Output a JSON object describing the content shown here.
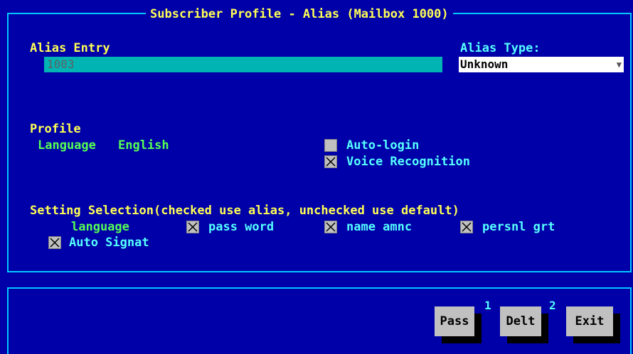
{
  "window": {
    "title": "Subscriber Profile - Alias (Mailbox 1000)"
  },
  "alias": {
    "entry_label": "Alias Entry",
    "entry_value": "1003",
    "type_label": "Alias Type:",
    "type_value": "Unknown"
  },
  "profile": {
    "heading": "Profile",
    "language_label": "Language",
    "language_value": "English",
    "auto_login_label": "Auto-login",
    "auto_login_checked": false,
    "voice_recognition_label": "Voice Recognition",
    "voice_recognition_checked": true
  },
  "settings": {
    "heading": "Setting Selection(checked use alias, unchecked use default)",
    "language_label": "language",
    "password_label": "pass word",
    "password_checked": true,
    "name_amnc_label": "name amnc",
    "name_amnc_checked": true,
    "persnl_grt_label": "persnl grt",
    "persnl_grt_checked": true,
    "auto_signat_label": "Auto Signat",
    "auto_signat_checked": true
  },
  "buttons": {
    "pass_label": "Pass",
    "pass_badge": "1",
    "delt_label": "Delt",
    "delt_badge": "2",
    "exit_label": "Exit"
  }
}
